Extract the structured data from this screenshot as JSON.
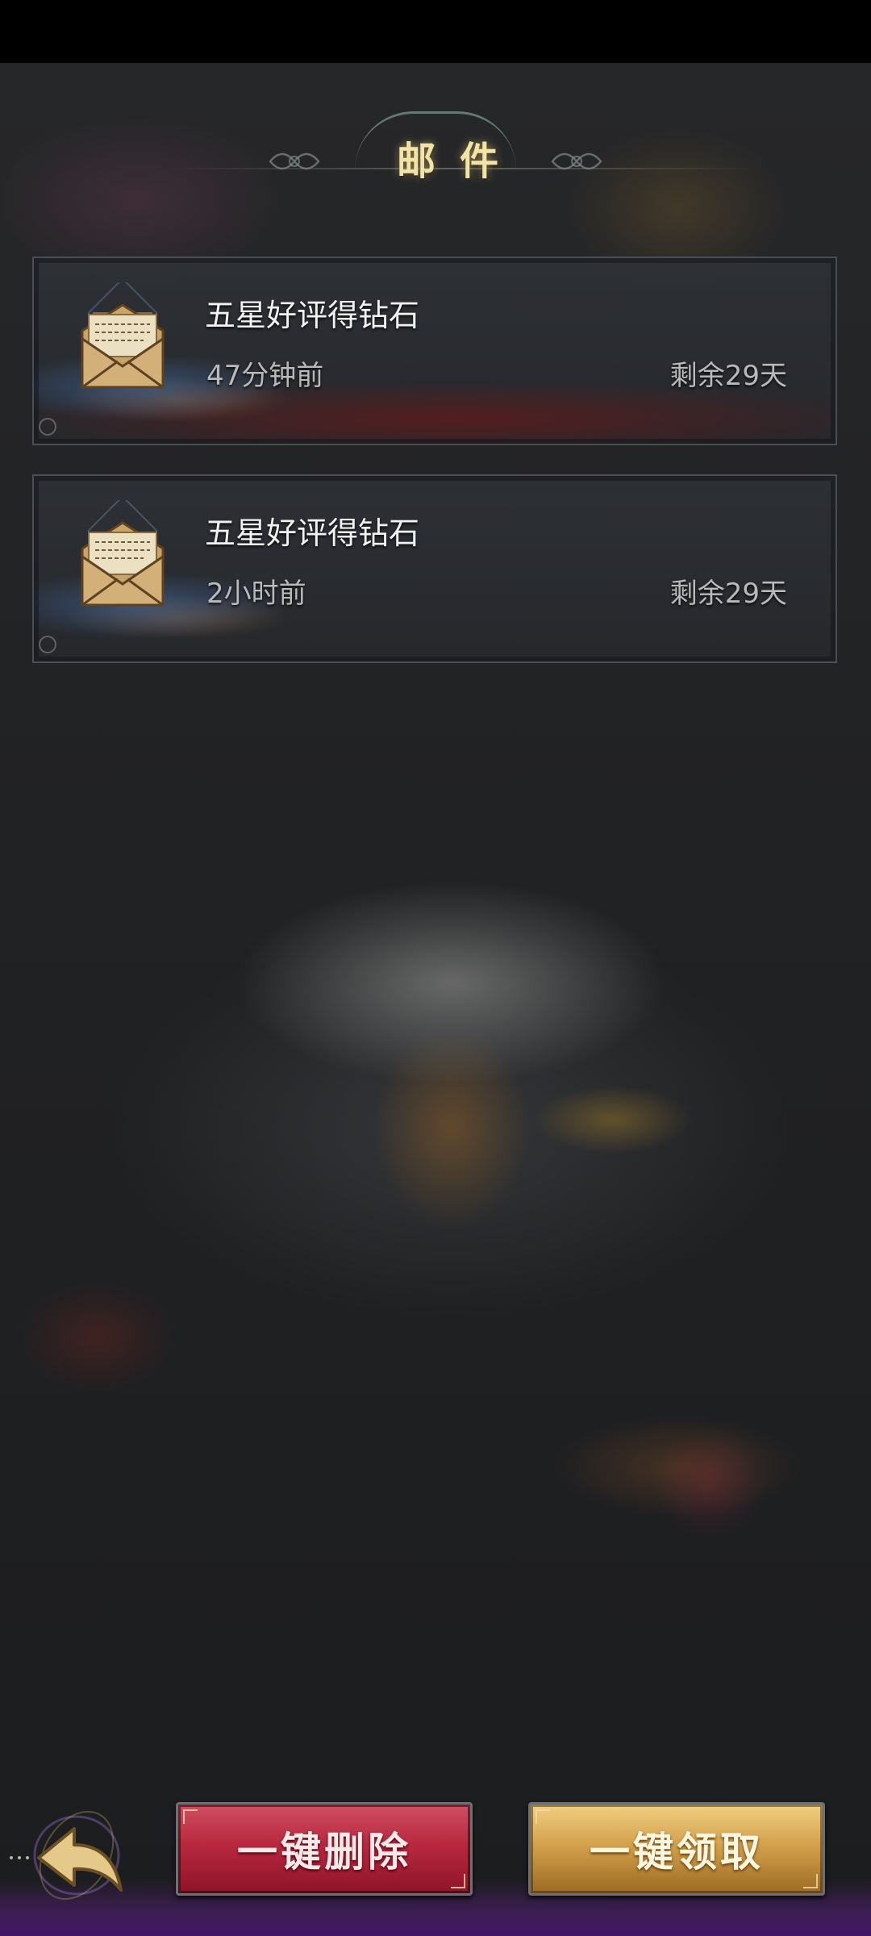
{
  "header": {
    "title": "邮件"
  },
  "mails": [
    {
      "title": "五星好评得钻石",
      "time": "47分钟前",
      "remaining": "剩余29天",
      "icon": "open-envelope-icon"
    },
    {
      "title": "五星好评得钻石",
      "time": "2小时前",
      "remaining": "剩余29天",
      "icon": "open-envelope-icon"
    }
  ],
  "actions": {
    "delete_all_label": "一键删除",
    "claim_all_label": "一键领取",
    "back_icon": "back-arrow-icon"
  },
  "colors": {
    "title_gold": "#f2e3a8",
    "delete_red": "#b8283f",
    "claim_gold": "#d4a24d",
    "card_border": "#4a4d52"
  }
}
